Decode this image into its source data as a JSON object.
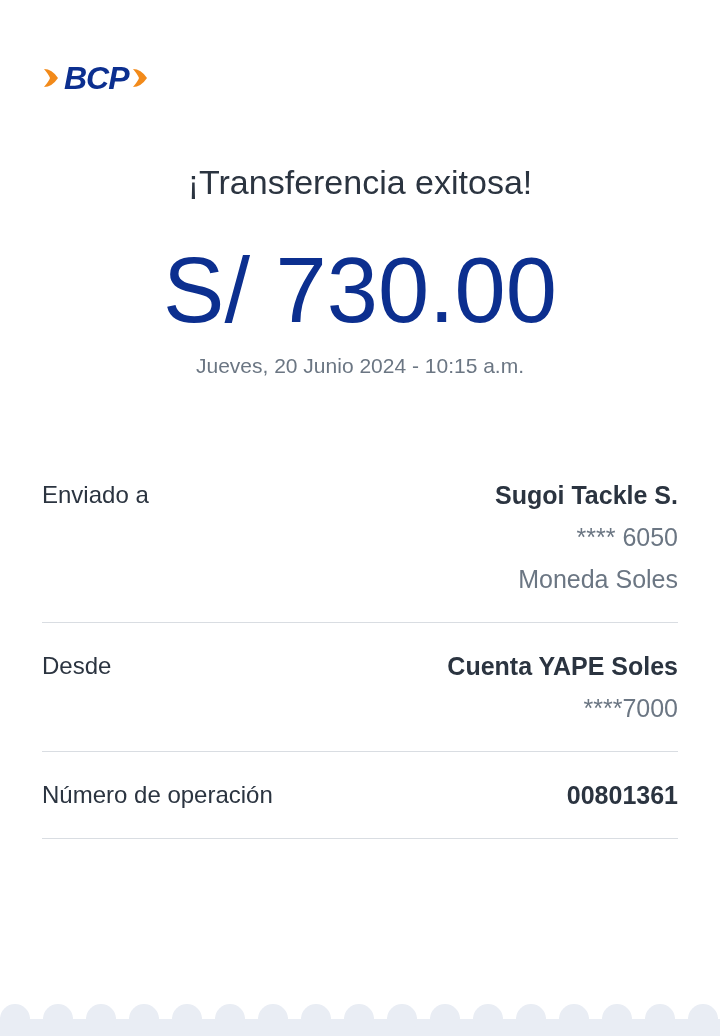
{
  "logo": {
    "text": "BCP"
  },
  "title": "¡Transferencia exitosa!",
  "amount": "S/ 730.00",
  "date": "Jueves, 20 Junio 2024 - 10:15 a.m.",
  "details": [
    {
      "label": "Enviado a",
      "values": [
        {
          "text": "Sugoi Tackle S.",
          "bold": true
        },
        {
          "text": "**** 6050",
          "bold": false
        },
        {
          "text": "Moneda Soles",
          "bold": false
        }
      ]
    },
    {
      "label": "Desde",
      "values": [
        {
          "text": "Cuenta YAPE Soles",
          "bold": true
        },
        {
          "text": "****7000",
          "bold": false
        }
      ]
    },
    {
      "label": "Número de operación",
      "values": [
        {
          "text": "00801361",
          "bold": true
        }
      ]
    }
  ]
}
